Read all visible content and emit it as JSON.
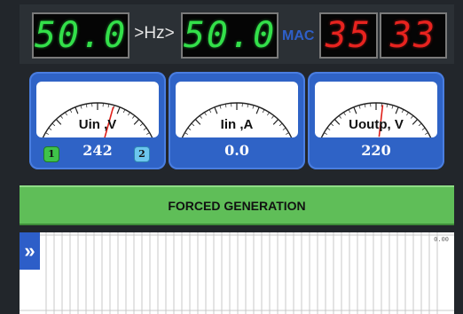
{
  "frequency": {
    "input": "50.0",
    "separator": ">Hz>",
    "output": "50.0"
  },
  "mac_label": "MAC",
  "timer": {
    "minutes": "35",
    "seconds": "33"
  },
  "meters": [
    {
      "label": "Uin ,V",
      "reading": "242",
      "needle_fraction": 0.62
    },
    {
      "label": "Iin ,A",
      "reading": "0.0",
      "needle_fraction": 0.0
    },
    {
      "label": "Uoutp, V",
      "reading": "220",
      "needle_fraction": 0.55
    }
  ],
  "phase_badges": [
    "1",
    "2"
  ],
  "banner": {
    "text": "FORCED GENERATION"
  },
  "plot": {
    "max_label": "0.00",
    "expand_icon": "double-chevron-right-icon"
  },
  "colors": {
    "frequency_digits": "#33e04a",
    "timer_digits": "#e8231f",
    "panel_blue": "#2f63c6",
    "banner_green": "#5fbe58"
  }
}
